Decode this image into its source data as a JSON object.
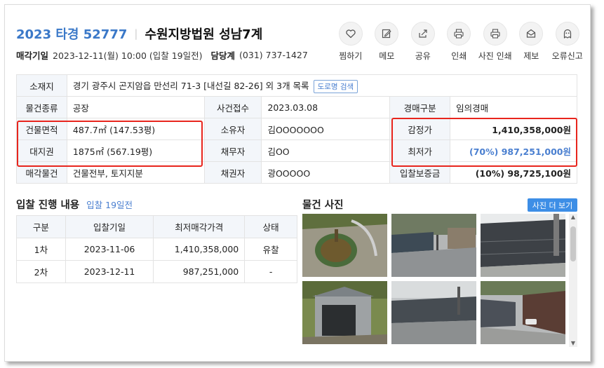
{
  "header": {
    "case_number": "2023 타경 52777",
    "court": "수원지방법원 성남7계",
    "sale_date_label": "매각기일",
    "sale_date_value": "2023-12-11(월) 10:00 (입찰 19일전)",
    "division_label": "담당계",
    "division_value": "(031) 737-1427"
  },
  "actions": [
    {
      "label": "찜하기",
      "icon": "heart-icon"
    },
    {
      "label": "메모",
      "icon": "pencil-icon"
    },
    {
      "label": "공유",
      "icon": "share-icon"
    },
    {
      "label": "인쇄",
      "icon": "printer-icon"
    },
    {
      "label": "사진 인쇄",
      "icon": "printer-icon"
    },
    {
      "label": "제보",
      "icon": "envelope-icon"
    },
    {
      "label": "오류신고",
      "icon": "ghost-icon"
    }
  ],
  "info": {
    "location_label": "소재지",
    "location_value": "경기 광주시 곤지암읍 만선리 71-3 [내선길 82-26] 외 3개 목록",
    "road_search": "도로명 검색",
    "type_label": "물건종류",
    "type_value": "공장",
    "received_label": "사건접수",
    "received_value": "2023.03.08",
    "auction_kind_label": "경매구분",
    "auction_kind_value": "임의경매",
    "building_area_label": "건물면적",
    "building_area_value": "487.7㎡ (147.53평)",
    "owner_label": "소유자",
    "owner_value": "김OOOOOOO",
    "appraisal_label": "감정가",
    "appraisal_value": "1,410,358,000원",
    "land_right_label": "대지권",
    "land_right_value": "1875㎡ (567.19평)",
    "debtor_label": "채무자",
    "debtor_value": "김OO",
    "minimum_label": "최저가",
    "minimum_value": "(70%) 987,251,000원",
    "sale_object_label": "매각물건",
    "sale_object_value": "건물전부, 토지지분",
    "creditor_label": "채권자",
    "creditor_value": "광OOOOO",
    "deposit_label": "입찰보증금",
    "deposit_value": "(10%) 98,725,100원"
  },
  "bidding": {
    "title": "입찰 진행 내용",
    "note": "입찰 19일전",
    "headers": [
      "구분",
      "입찰기일",
      "최저매각가격",
      "상태"
    ],
    "rows": [
      [
        "1차",
        "2023-11-06",
        "1,410,358,000",
        "유찰"
      ],
      [
        "2차",
        "2023-12-11",
        "987,251,000",
        "-"
      ]
    ]
  },
  "photos": {
    "title": "물건 사진",
    "more_button": "사진 더 보기"
  },
  "colors": {
    "accent_blue": "#3a78c8",
    "highlight_red": "#e8251d",
    "button_blue": "#3d8ee6"
  }
}
